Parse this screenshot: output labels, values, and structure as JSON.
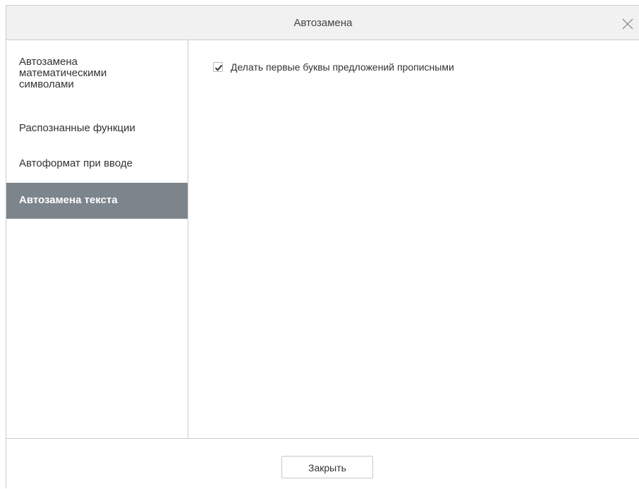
{
  "dialog": {
    "title": "Автозамена",
    "close_icon": "close-icon"
  },
  "sidebar": {
    "items": [
      {
        "label": "Автозамена математическими символами",
        "selected": false
      },
      {
        "label": "Распознанные функции",
        "selected": false
      },
      {
        "label": "Автоформат при вводе",
        "selected": false
      },
      {
        "label": "Автозамена текста",
        "selected": true
      }
    ],
    "selected_color": "#7d858c"
  },
  "content": {
    "options": [
      {
        "label": "Делать первые буквы предложений прописными",
        "checked": true
      }
    ]
  },
  "footer": {
    "close_label": "Закрыть"
  }
}
